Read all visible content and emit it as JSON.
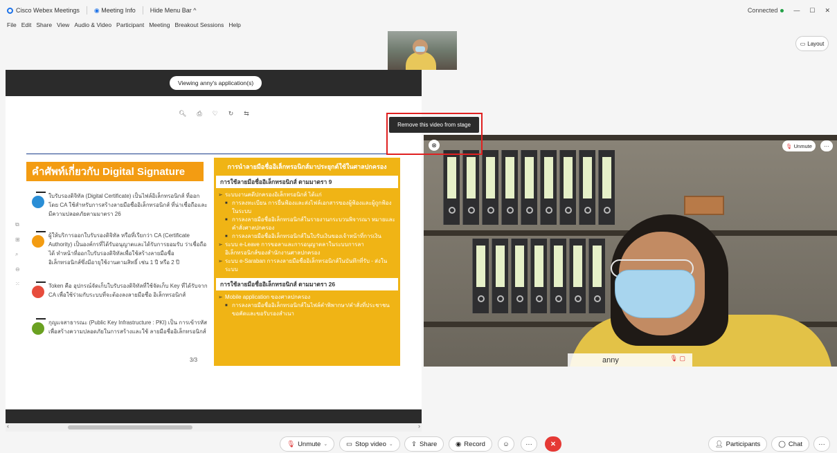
{
  "titlebar": {
    "app_name": "Cisco Webex Meetings",
    "meeting_info": "Meeting Info",
    "hide_menu": "Hide Menu Bar ^",
    "status": "Connected",
    "window_controls": [
      "—",
      "☐",
      "✕"
    ]
  },
  "menu": [
    "File",
    "Edit",
    "Share",
    "View",
    "Audio & Video",
    "Participant",
    "Meeting",
    "Breakout Sessions",
    "Help"
  ],
  "layout_button": "Layout",
  "share": {
    "viewing_label": "Viewing anny's application(s)",
    "page_number": "3/3"
  },
  "slide": {
    "title": "คำศัพท์เกี่ยวกับ Digital Signature",
    "terms": [
      {
        "text": "ใบรับรองดิจิทัล (Digital Certificate) เป็นไฟล์อิเล็กทรอนิกส์ ที่ออกโดย CA ใช้สำหรับการสร้างลายมือชื่ออิเล็กทรอนิกส์ ที่น่าเชื่อถือและมีความปลอดภัยตามมาตรา 26",
        "color": "#2a8ed6"
      },
      {
        "text": "ผู้ให้บริการออกใบรับรองดิจิทัล หรือที่เรียกว่า CA (Certificate Authority) เป็นองค์กรที่ได้รับอนุญาตและได้รับการยอมรับ ว่าเชื่อถือได้ ทำหน้าที่ออกใบรับรองดิจิทัลเพื่อใช้สร้างลายมือชื่อ อิเล็กทรอนิกส์ซึ่งมีอายุใช้งานตามสิทธิ์ เช่น 1 ปี หรือ 2 ปี",
        "color": "#f39c12"
      },
      {
        "text": "Token คือ อุปกรณ์จัดเก็บใบรับรองดิจิทัลที่ใช้จัดเก็บ Key ที่ได้รับจาก CA เพื่อใช้ร่วมกับระบบที่จะต้องลงลายมือชื่อ อิเล็กทรอนิกส์",
        "color": "#e74c3c"
      },
      {
        "text": "กุญแจสาธารณะ (Public Key Infrastructure : PKI) เป็น การเข้ารหัสเพื่อสร้างความปลอดภัยในการสร้างและใช้ ลายมือชื่ออิเล็กทรอนิกส์",
        "color": "#6aa121"
      }
    ],
    "panel_heading": "การนำลายมือชื่ออิเล็กทรอนิกส์มาประยุกต์ใช้ในศาลปกครอง",
    "section1_title": "การใช้ลายมือชื่ออิเล็กทรอนิกส์ ตามมาตรา 9",
    "section1_lines": [
      {
        "type": "arrow",
        "text": "ระบบงานคดีปกครองอิเล็กทรอนิกส์ ได้แก่"
      },
      {
        "type": "bullet",
        "text": "การลงทะเบียน การยื่นฟ้องและส่งไฟล์เอกสารของผู้ฟ้องและผู้ถูกฟ้องในระบบ"
      },
      {
        "type": "bullet",
        "text": "การลงลายมือชื่ออิเล็กทรอนิกส์ในรายงานกระบวนพิจารณา หมายและคำสั่งศาลปกครอง"
      },
      {
        "type": "bullet",
        "text": "การลงลายมือชื่ออิเล็กทรอนิกส์ในใบรับเงินของเจ้าหน้าที่การเงิน"
      },
      {
        "type": "arrow",
        "text": "ระบบ e-Leave การขอลาและการอนุญาตลาในระบบการลาอิเล็กทรอนิกส์ของสำนักงานศาลปกครอง"
      },
      {
        "type": "arrow",
        "text": "ระบบ e-Saraban การลงลายมือชื่ออิเล็กทรอนิกส์ในบันทึกที่รับ - ส่งในระบบ"
      }
    ],
    "section2_title": "การใช้ลายมือชื่ออิเล็กทรอนิกส์ ตามมาตรา 26",
    "section2_lines": [
      {
        "type": "arrow",
        "text": "Mobile application ของศาลปกครอง"
      },
      {
        "type": "bullet",
        "text": "การลงลายมือชื่ออิเล็กทรอนิกส์ในไฟล์คำพิพากษา/คำสั่งที่ประชาชนขอคัดและขอรับรองสำเนา"
      }
    ]
  },
  "video": {
    "tooltip": "Remove this video from stage",
    "participant_name": "anny",
    "unmute_label": "Unmute",
    "more_label": "···"
  },
  "controls": {
    "unmute": "Unmute",
    "stop_video": "Stop video",
    "share": "Share",
    "record": "Record",
    "reactions": "☺",
    "more": "···",
    "leave": "✕",
    "participants": "Participants",
    "chat": "Chat",
    "more_right": "···"
  },
  "colors": {
    "accent_blue": "#1d72e8",
    "leave_red": "#e53935",
    "highlight_red": "#e02020",
    "slide_orange": "#f39c12",
    "panel_yellow": "#f0b415"
  }
}
